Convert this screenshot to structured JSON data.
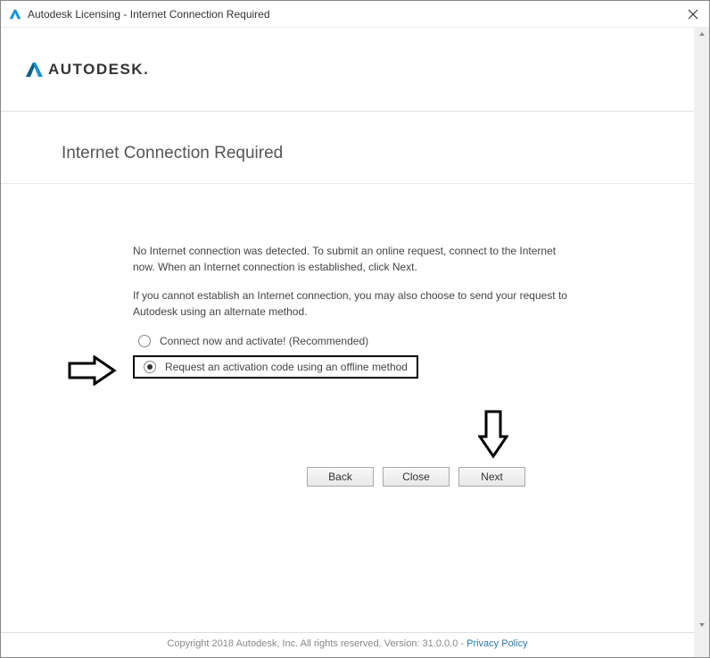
{
  "window": {
    "title": "Autodesk Licensing - Internet Connection Required"
  },
  "header": {
    "brand_text": "AUTODESK",
    "brand_suffix": "."
  },
  "page": {
    "title": "Internet Connection Required",
    "paragraph1": "No Internet connection was detected. To submit an online request, connect to the Internet now. When an Internet connection is established, click Next.",
    "paragraph2": "If you cannot establish an Internet connection, you may also choose to send your request to Autodesk using an alternate method."
  },
  "radios": {
    "option1": {
      "label": "Connect now and activate! (Recommended)",
      "selected": false
    },
    "option2": {
      "label": "Request an activation code using an offline method",
      "selected": true
    }
  },
  "buttons": {
    "back": "Back",
    "close": "Close",
    "next": "Next"
  },
  "footer": {
    "copyright": "Copyright 2018 Autodesk, Inc. All rights reserved. Version: 31.0.0.0 - ",
    "link_text": "Privacy Policy"
  }
}
